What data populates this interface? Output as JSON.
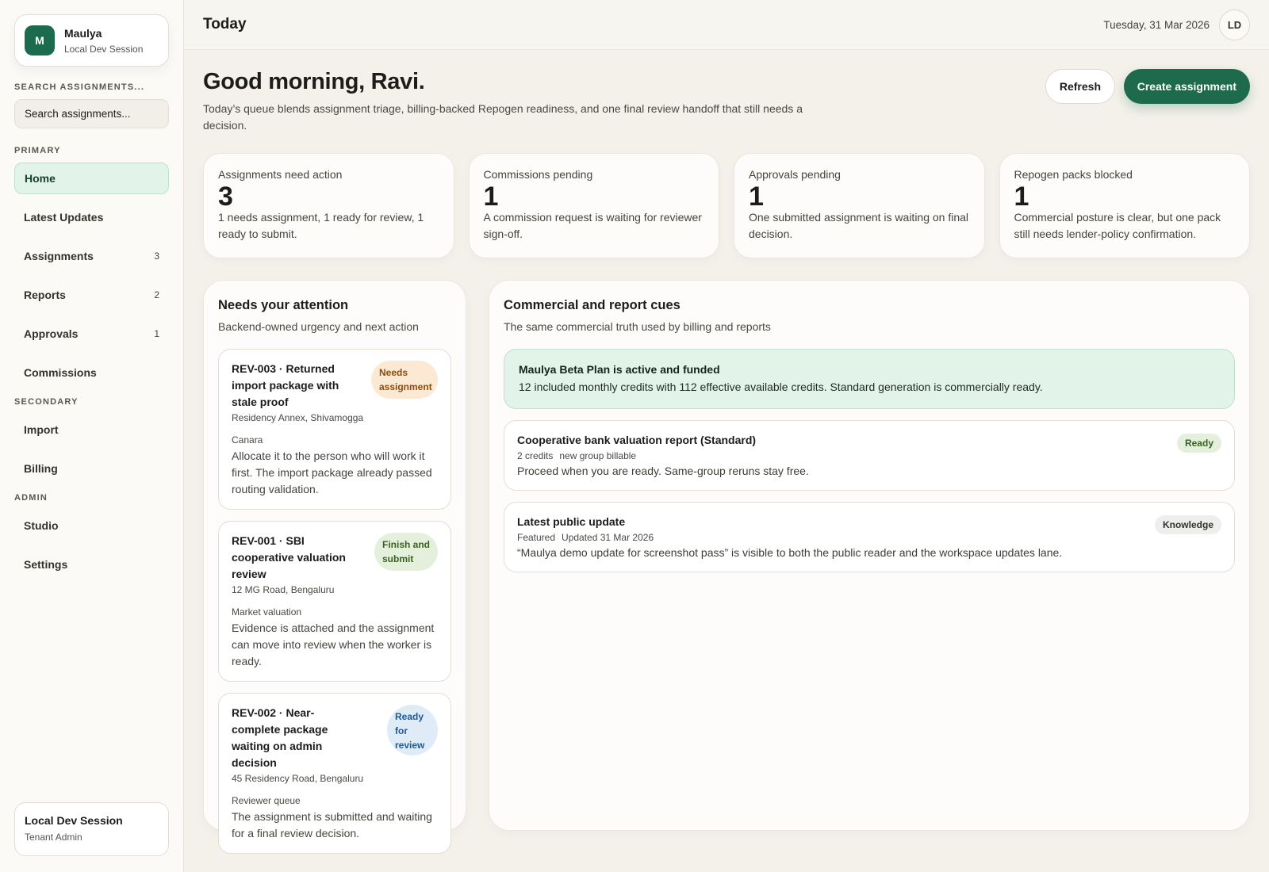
{
  "workspace": {
    "initial": "M",
    "name": "Maulya",
    "session": "Local Dev Session"
  },
  "sidebar": {
    "search_label": "SEARCH ASSIGNMENTS...",
    "search_placeholder": "Search assignments...",
    "sections": {
      "primary": "PRIMARY",
      "secondary": "SECONDARY",
      "admin": "ADMIN"
    },
    "primary_items": [
      {
        "label": "Home",
        "count": ""
      },
      {
        "label": "Latest Updates",
        "count": ""
      },
      {
        "label": "Assignments",
        "count": "3"
      },
      {
        "label": "Reports",
        "count": "2"
      },
      {
        "label": "Approvals",
        "count": "1"
      },
      {
        "label": "Commissions",
        "count": ""
      }
    ],
    "secondary_items": [
      {
        "label": "Import"
      },
      {
        "label": "Billing"
      }
    ],
    "admin_items": [
      {
        "label": "Studio"
      },
      {
        "label": "Settings"
      }
    ],
    "session_card": {
      "title": "Local Dev Session",
      "role": "Tenant Admin"
    }
  },
  "topbar": {
    "title": "Today",
    "date": "Tuesday, 31 Mar 2026",
    "user_initials": "LD"
  },
  "header": {
    "greeting": "Good morning, Ravi.",
    "intro": "Today’s queue blends assignment triage, billing-backed Repogen readiness, and one final review handoff that still needs a decision.",
    "refresh_label": "Refresh",
    "create_label": "Create assignment"
  },
  "kpis": [
    {
      "label": "Assignments need action",
      "value": "3",
      "desc": "1 needs assignment, 1 ready for review, 1 ready to submit."
    },
    {
      "label": "Commissions pending",
      "value": "1",
      "desc": "A commission request is waiting for reviewer sign-off."
    },
    {
      "label": "Approvals pending",
      "value": "1",
      "desc": "One submitted assignment is waiting on final decision."
    },
    {
      "label": "Repogen packs blocked",
      "value": "1",
      "desc": "Commercial posture is clear, but one pack still needs lender-policy confirmation."
    }
  ],
  "attention": {
    "title": "Needs your attention",
    "subtitle": "Backend-owned urgency and next action",
    "items": [
      {
        "title": "REV-003 · Returned import package with stale proof",
        "location": "Residency Annex, Shivamogga",
        "category": "Canara",
        "desc": "Allocate it to the person who will work it first. The import package already passed routing validation.",
        "status": "Needs assignment"
      },
      {
        "title": "REV-001 · SBI cooperative valuation review",
        "location": "12 MG Road, Bengaluru",
        "category": "Market valuation",
        "desc": "Evidence is attached and the assignment can move into review when the worker is ready.",
        "status": "Finish and submit"
      },
      {
        "title": "REV-002 · Near-complete package waiting on admin decision",
        "location": "45 Residency Road, Bengaluru",
        "category": "Reviewer queue",
        "desc": "The assignment is submitted and waiting for a final review decision.",
        "status": "Ready for review"
      }
    ]
  },
  "cues": {
    "title": "Commercial and report cues",
    "subtitle": "The same commercial truth used by billing and reports",
    "plan": {
      "title": "Maulya Beta Plan is active and funded",
      "desc": "12 included monthly credits with 112 effective available credits. Standard generation is commercially ready."
    },
    "cards": [
      {
        "title": "Cooperative bank valuation report (Standard)",
        "meta1": "2 credits",
        "meta2": "new group billable",
        "desc": "Proceed when you are ready. Same-group reruns stay free.",
        "pill": "Ready"
      },
      {
        "title": "Latest public update",
        "meta1": "Featured",
        "meta2": "Updated 31 Mar 2026",
        "desc": "“Maulya demo update for screenshot pass” is visible to both the public reader and the workspace updates lane.",
        "pill": "Knowledge"
      }
    ]
  },
  "colors": {
    "accent": "#1d6a4d",
    "active_bg": "#e2f3ea",
    "page_bg": "#f4f1ea"
  }
}
